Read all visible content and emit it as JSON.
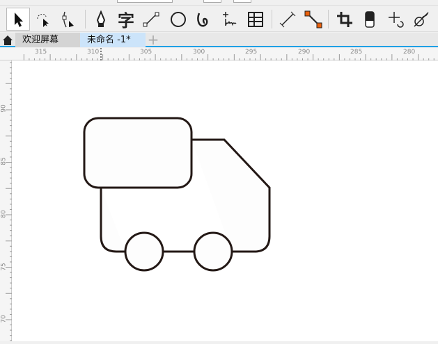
{
  "toolbar": {
    "tools": [
      {
        "name": "pick-tool",
        "selected": true
      },
      {
        "name": "freehand-pick-tool"
      },
      {
        "name": "shape-tool"
      },
      {
        "name": "pen-tool"
      },
      {
        "name": "text-tool",
        "glyph": "字"
      },
      {
        "name": "line-tool"
      },
      {
        "name": "ellipse-tool"
      },
      {
        "name": "artistic-media-tool"
      },
      {
        "name": "smart-drawing-tool"
      },
      {
        "name": "table-tool"
      },
      {
        "name": "dimension-tool"
      },
      {
        "name": "connector-tool"
      },
      {
        "name": "crop-tool"
      },
      {
        "name": "eraser-tool"
      },
      {
        "name": "transform-tool"
      },
      {
        "name": "blend-tool"
      }
    ]
  },
  "tabs": {
    "home": "home-icon",
    "items": [
      {
        "label": "欢迎屏幕"
      },
      {
        "label": "未命名 -1*",
        "active": true
      }
    ],
    "add": "+"
  },
  "ruler": {
    "horizontal": [
      "315",
      "310",
      "305",
      "300",
      "295",
      "290",
      "285",
      "280"
    ],
    "vertical": [
      "90",
      "85",
      "80",
      "75",
      "70"
    ]
  },
  "colors": {
    "accent": "#1ea0e6",
    "stroke": "#231815",
    "connector": "#e8600c"
  }
}
